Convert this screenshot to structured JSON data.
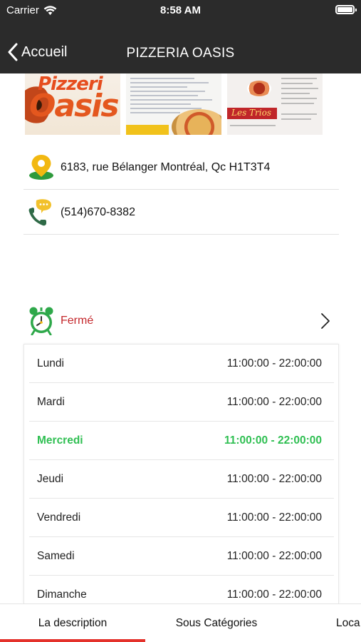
{
  "status_bar": {
    "carrier": "Carrier",
    "time": "8:58 AM"
  },
  "nav": {
    "back_label": "Accueil",
    "title": "PIZZERIA OASIS"
  },
  "gallery": {
    "images": [
      {
        "name": "storefront-sign",
        "text_top": "Pizzeri",
        "text_bottom": "Oasis"
      },
      {
        "name": "menu-page-pizza"
      },
      {
        "name": "menu-page-trios",
        "text": "Les Trios"
      }
    ]
  },
  "contact": {
    "address": "6183, rue Bélanger Montréal, Qc H1T3T4",
    "phone": "(514)670-8382"
  },
  "opening": {
    "status_label": "Fermé",
    "status_color": "#c4282c",
    "today_color": "#2fbf52",
    "hours": [
      {
        "day": "Lundi",
        "time": "11:00:00 - 22:00:00",
        "today": false
      },
      {
        "day": "Mardi",
        "time": "11:00:00 - 22:00:00",
        "today": false
      },
      {
        "day": "Mercredi",
        "time": "11:00:00 - 22:00:00",
        "today": true
      },
      {
        "day": "Jeudi",
        "time": "11:00:00 - 22:00:00",
        "today": false
      },
      {
        "day": "Vendredi",
        "time": "11:00:00 - 22:00:00",
        "today": false
      },
      {
        "day": "Samedi",
        "time": "11:00:00 - 22:00:00",
        "today": false
      },
      {
        "day": "Dimanche",
        "time": "11:00:00 - 22:00:00",
        "today": false
      }
    ]
  },
  "tabs": [
    {
      "label": "La description",
      "active": true
    },
    {
      "label": "Sous Catégories",
      "active": false
    },
    {
      "label": "Loca",
      "active": false
    }
  ],
  "colors": {
    "nav_bg": "#2b2b2b",
    "tab_indicator": "#e4312b"
  }
}
